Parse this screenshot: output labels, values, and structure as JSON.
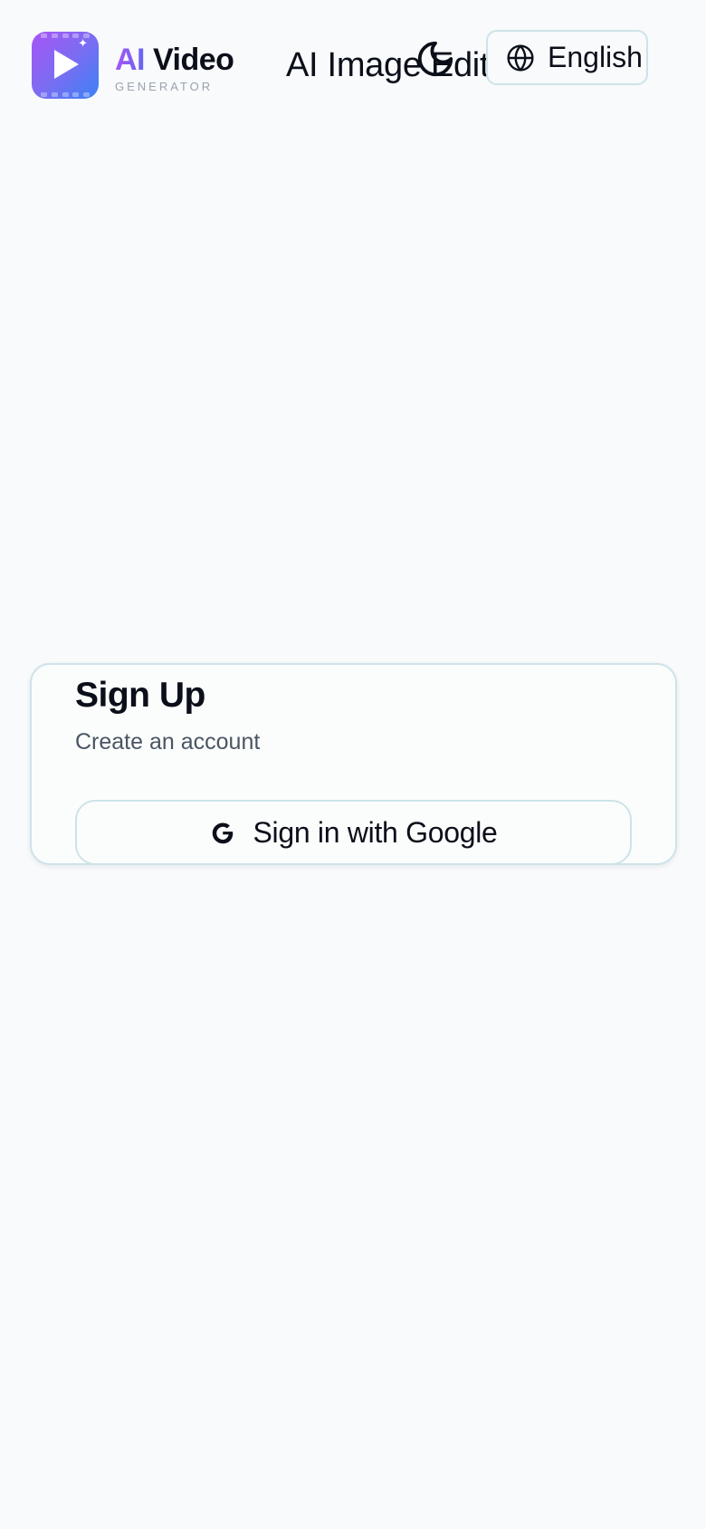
{
  "header": {
    "brand": {
      "name_accent": "AI",
      "name_main": "Video",
      "tagline": "GENERATOR",
      "logo_icon": "play-video-icon"
    },
    "nav_link_label": "AI Image Edit",
    "theme_toggle_icon": "moon-icon",
    "language": {
      "icon": "globe-icon",
      "label": "English"
    }
  },
  "signup_card": {
    "title": "Sign Up",
    "subtitle": "Create an account",
    "google_button": {
      "icon": "google-icon",
      "label": "Sign in with Google"
    }
  },
  "colors": {
    "background": "#f8fafc",
    "border": "#cde3e8",
    "brand_gradient_start": "#a855f7",
    "brand_gradient_end": "#3b82f6",
    "text_primary": "#0b0f19",
    "text_secondary": "#4b5563"
  }
}
